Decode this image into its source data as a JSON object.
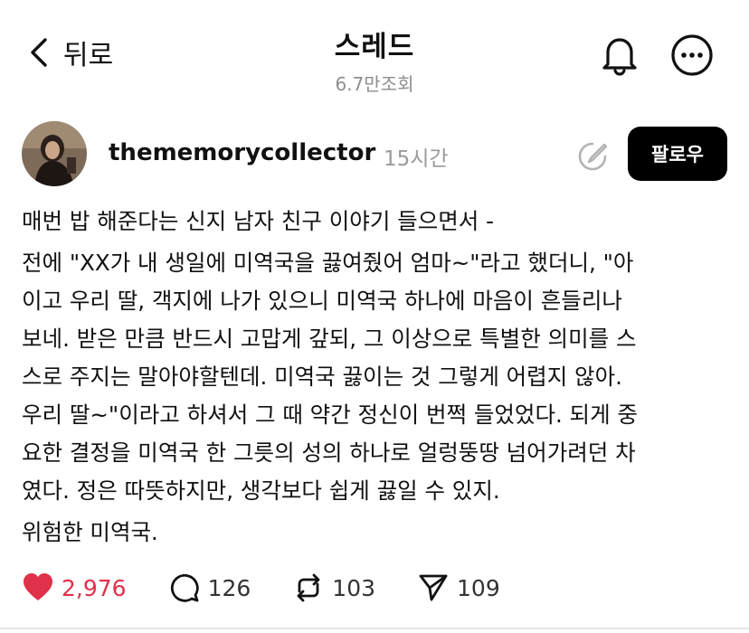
{
  "header": {
    "back_label": "뒤로",
    "title": "스레드",
    "views": "6.7만조회"
  },
  "post": {
    "username": "thememorycollector",
    "time": "15시간",
    "follow_label": "팔로우",
    "lines": [
      "매번 밥 해준다는 신지 남자 친구 이야기 들으면서 -",
      "전에 \"XX가 내 생일에 미역국을 끓여줬어 엄마~\"라고 했더니, \"아",
      "이고 우리 딸, 객지에 나가 있으니 미역국 하나에 마음이 흔들리나",
      "보네. 받은 만큼 반드시 고맙게 갚되, 그 이상으로 특별한 의미를 스",
      "스로 주지는 말아야할텐데. 미역국 끓이는 것 그렇게 어렵지 않아.",
      "우리 딸~\"이라고 하셔서 그 때 약간 정신이 번쩍 들었었다. 되게 중",
      "요한 결정을 미역국 한 그릇의 성의 하나로 얼렁뚱땅 넘어가려던 차",
      "였다. 정은 따뜻하지만, 생각보다 쉽게 끓일 수 있지.",
      "위험한 미역국."
    ],
    "stats": {
      "likes": "2,976",
      "comments": "126",
      "reposts": "103",
      "shares": "109"
    }
  },
  "colors": {
    "like": "#e0314a",
    "follow_bg": "#000000"
  }
}
